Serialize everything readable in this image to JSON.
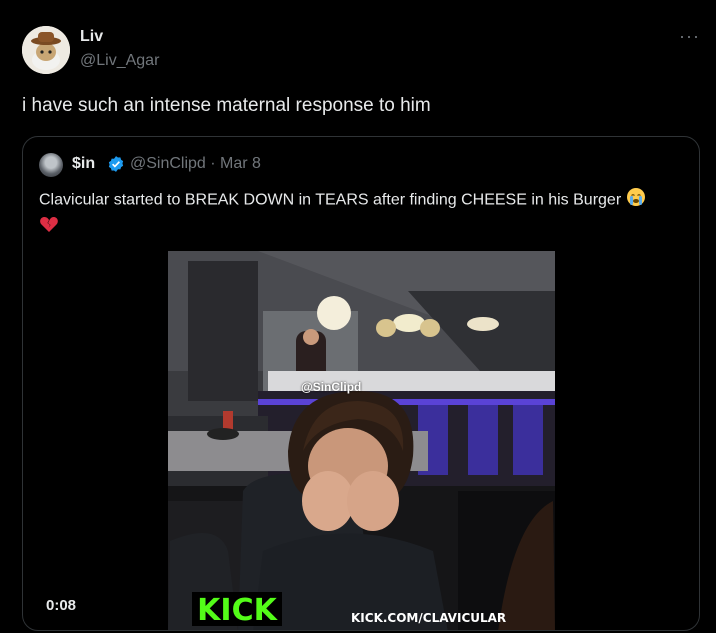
{
  "tweet": {
    "display_name": "Liv",
    "handle": "@Liv_Agar",
    "text": "i have such an intense maternal response to him",
    "more_label": "···"
  },
  "quoted": {
    "display_name": "$in",
    "handle_date": "@SinClipd · Mar 8",
    "text": "Clavicular started to BREAK DOWN in TEARS after finding CHEESE in his Burger",
    "video": {
      "timestamp": "0:08",
      "logo_text": "KICK",
      "url_text": "KICK.COM/CLAVICULAR",
      "watermark": "@SinClipd"
    }
  },
  "colors": {
    "background": "#000000",
    "text": "#e7e9ea",
    "secondary": "#71767b",
    "border": "#2f3336",
    "verified": "#1d9bf0",
    "kick_green": "#53fc18"
  },
  "icons": {
    "verified": "verified-badge-icon",
    "emoji_crying": "loudly-crying-face-icon",
    "emoji_heart": "broken-heart-icon"
  }
}
